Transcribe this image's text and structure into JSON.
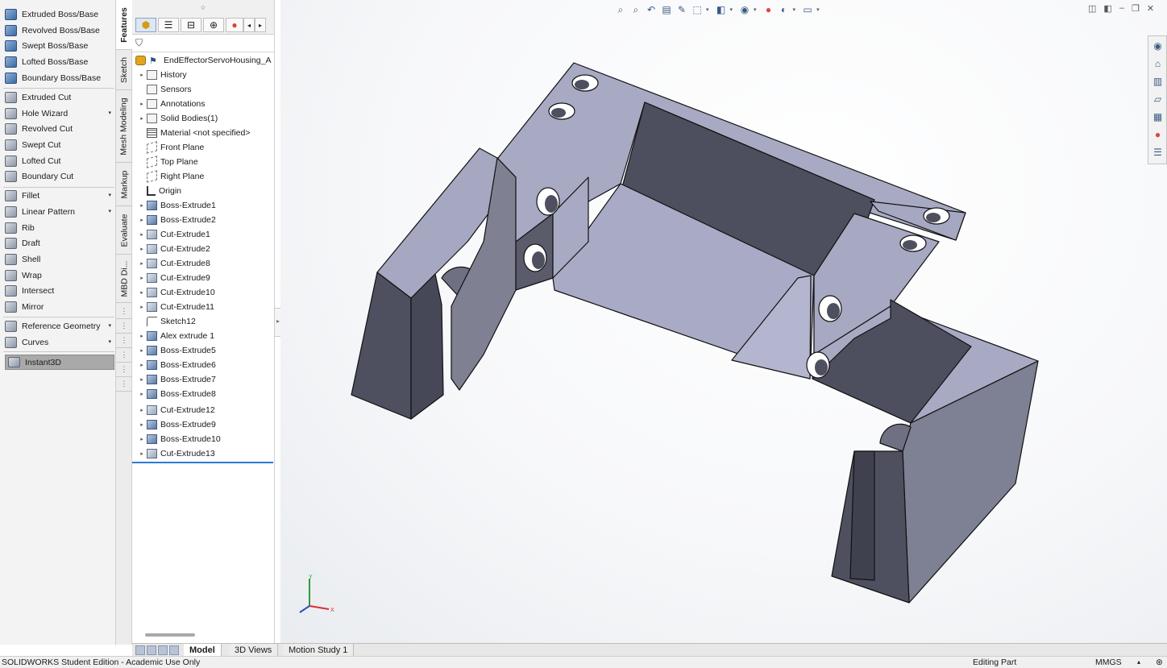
{
  "command_manager": {
    "items": [
      {
        "label": "Extruded Boss/Base",
        "icon": "extruded-boss-icon"
      },
      {
        "label": "Revolved Boss/Base",
        "icon": "revolved-boss-icon"
      },
      {
        "label": "Swept Boss/Base",
        "icon": "swept-boss-icon"
      },
      {
        "label": "Lofted Boss/Base",
        "icon": "lofted-boss-icon"
      },
      {
        "label": "Boundary Boss/Base",
        "icon": "boundary-boss-icon"
      },
      {
        "label": "Extruded Cut",
        "icon": "extruded-cut-icon"
      },
      {
        "label": "Hole Wizard",
        "icon": "hole-wizard-icon"
      },
      {
        "label": "Revolved Cut",
        "icon": "revolved-cut-icon"
      },
      {
        "label": "Swept Cut",
        "icon": "swept-cut-icon"
      },
      {
        "label": "Lofted Cut",
        "icon": "lofted-cut-icon"
      },
      {
        "label": "Boundary Cut",
        "icon": "boundary-cut-icon"
      },
      {
        "label": "Fillet",
        "icon": "fillet-icon"
      },
      {
        "label": "Linear Pattern",
        "icon": "linear-pattern-icon"
      },
      {
        "label": "Rib",
        "icon": "rib-icon"
      },
      {
        "label": "Draft",
        "icon": "draft-icon"
      },
      {
        "label": "Shell",
        "icon": "shell-icon"
      },
      {
        "label": "Wrap",
        "icon": "wrap-icon"
      },
      {
        "label": "Intersect",
        "icon": "intersect-icon"
      },
      {
        "label": "Mirror",
        "icon": "mirror-icon"
      },
      {
        "label": "Reference Geometry",
        "icon": "reference-geometry-icon"
      },
      {
        "label": "Curves",
        "icon": "curves-icon"
      },
      {
        "label": "Instant3D",
        "icon": "instant3d-icon"
      }
    ]
  },
  "vertical_tabs": [
    "Features",
    "Sketch",
    "Mesh Modeling",
    "Markup",
    "Evaluate",
    "MBD Di..."
  ],
  "feature_tree": {
    "root": "EndEffectorServoHousing_A",
    "nodes": [
      {
        "label": "History",
        "icon": "history-icon"
      },
      {
        "label": "Sensors",
        "icon": "sensors-icon"
      },
      {
        "label": "Annotations",
        "icon": "annotations-icon"
      },
      {
        "label": "Solid Bodies(1)",
        "icon": "solid-bodies-icon"
      },
      {
        "label": "Material <not specified>",
        "icon": "material-icon"
      },
      {
        "label": "Front Plane",
        "icon": "plane-icon"
      },
      {
        "label": "Top Plane",
        "icon": "plane-icon"
      },
      {
        "label": "Right Plane",
        "icon": "plane-icon"
      },
      {
        "label": "Origin",
        "icon": "origin-icon"
      },
      {
        "label": "Boss-Extrude1",
        "icon": "boss-extrude-icon"
      },
      {
        "label": "Boss-Extrude2",
        "icon": "boss-extrude-icon"
      },
      {
        "label": "Cut-Extrude1",
        "icon": "cut-extrude-icon"
      },
      {
        "label": "Cut-Extrude2",
        "icon": "cut-extrude-icon"
      },
      {
        "label": "Cut-Extrude8",
        "icon": "cut-extrude-icon"
      },
      {
        "label": "Cut-Extrude9",
        "icon": "cut-extrude-icon"
      },
      {
        "label": "Cut-Extrude10",
        "icon": "cut-extrude-icon"
      },
      {
        "label": "Cut-Extrude11",
        "icon": "cut-extrude-icon"
      },
      {
        "label": "Sketch12",
        "icon": "sketch-icon"
      },
      {
        "label": "Alex extrude 1",
        "icon": "boss-extrude-icon"
      },
      {
        "label": "Boss-Extrude5",
        "icon": "boss-extrude-icon"
      },
      {
        "label": "Boss-Extrude6",
        "icon": "boss-extrude-icon"
      },
      {
        "label": "Boss-Extrude7",
        "icon": "boss-extrude-icon"
      },
      {
        "label": "Boss-Extrude8",
        "icon": "boss-extrude-icon"
      },
      {
        "label": "Cut-Extrude12",
        "icon": "cut-extrude-icon"
      },
      {
        "label": "Boss-Extrude9",
        "icon": "boss-extrude-icon"
      },
      {
        "label": "Boss-Extrude10",
        "icon": "boss-extrude-icon"
      },
      {
        "label": "Cut-Extrude13",
        "icon": "cut-extrude-icon"
      }
    ]
  },
  "bottom_tabs": [
    "Model",
    "3D Views",
    "Motion Study 1"
  ],
  "status_bar": {
    "left": "SOLIDWORKS Student Edition - Academic Use Only",
    "mode": "Editing Part",
    "units": "MMGS"
  },
  "triad": {
    "x": "X",
    "y": "Y"
  },
  "colors": {
    "model_face": "#a7a9c2",
    "model_dark": "#4e5060",
    "tree_accent": "#2a7bd4"
  }
}
